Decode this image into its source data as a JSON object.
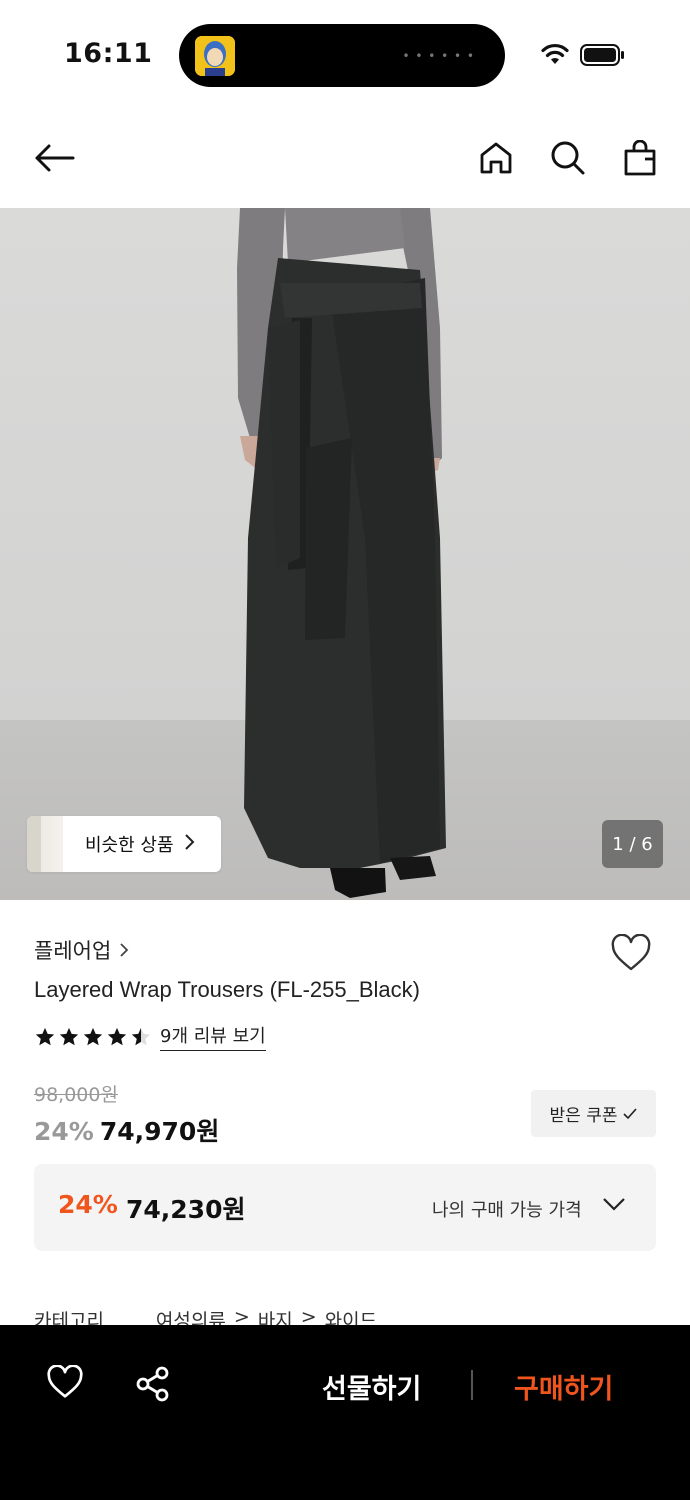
{
  "status_bar": {
    "time": "16:11"
  },
  "nav": {
    "back_icon": "arrow-left-icon",
    "home_icon": "home-icon",
    "search_icon": "search-icon",
    "cart_icon": "shopping-bag-icon"
  },
  "hero": {
    "similar_label": "비슷한 상품",
    "page_indicator": "1 / 6"
  },
  "product": {
    "brand": "플레어업",
    "title": "Layered Wrap Trousers (FL-255_Black)",
    "rating": 4.5,
    "review_link": "9개 리뷰 보기",
    "original_price": "98,000원",
    "discount_rate": "24%",
    "sale_price": "74,970원",
    "coupon_label": "받은 쿠폰"
  },
  "my_price": {
    "rate": "24%",
    "price": "74,230원",
    "label": "나의 구매 가능 가격"
  },
  "category": {
    "label": "카테고리",
    "path": [
      "여성의류",
      ">",
      "바지",
      ">",
      "와이드"
    ]
  },
  "bottom_bar": {
    "gift_label": "선물하기",
    "buy_label": "구매하기"
  },
  "colors": {
    "accent": "#f0551e",
    "bottom_bar": "#000000"
  }
}
